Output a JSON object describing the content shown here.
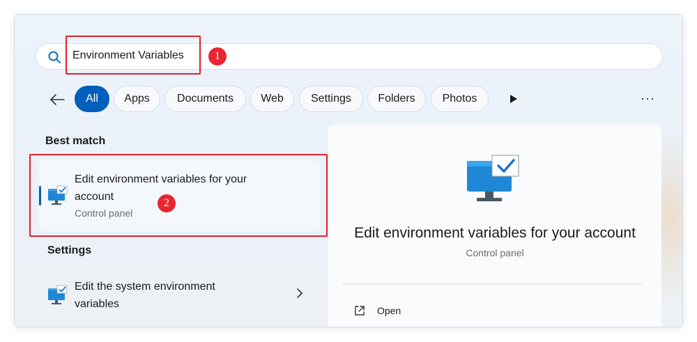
{
  "search": {
    "value": "Environment Variables",
    "icon": "search-icon"
  },
  "annotations": {
    "step1": "1",
    "step2": "2",
    "color": "#e0202a"
  },
  "filters": {
    "items": [
      "All",
      "Apps",
      "Documents",
      "Web",
      "Settings",
      "Folders",
      "Photos"
    ],
    "active": "All",
    "accent": "#005fb8"
  },
  "best_match": {
    "heading": "Best match",
    "item": {
      "title": "Edit environment variables for your account",
      "subtitle": "Control panel",
      "icon": "monitor-check-icon"
    }
  },
  "settings": {
    "heading": "Settings",
    "items": [
      {
        "title": "Edit the system environment variables",
        "icon": "monitor-check-icon"
      }
    ]
  },
  "detail": {
    "title": "Edit environment variables for your account",
    "subtitle": "Control panel",
    "actions": [
      {
        "label": "Open",
        "icon": "open-external-icon"
      }
    ]
  }
}
